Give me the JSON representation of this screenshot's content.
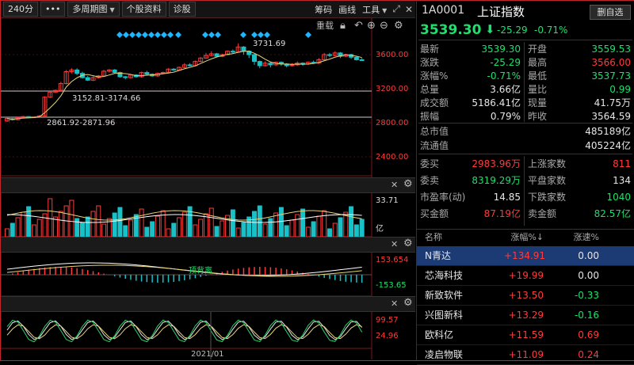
{
  "toolbar": {
    "period": "240分",
    "more": "•••",
    "multi_period": "多周期图",
    "stock_info": "个股资料",
    "diagnose": "诊股",
    "chips": "筹码",
    "draw": "画线",
    "tools": "工具"
  },
  "chart": {
    "overlay_label": "重载",
    "price_ticks": [
      "3600.00",
      "3200.00",
      "2800.00",
      "2400.00"
    ],
    "annot_high": "3731.69",
    "annot_range1": "3152.81-3174.66",
    "annot_range2": "2861.92-2871.96",
    "volume_top": "33.71",
    "volume_unit": "亿",
    "macd_top": "153.654",
    "macd_bottom": "-153.65",
    "macd_label": "顶背离",
    "kdj_top": "99.57",
    "kdj_bottom": "24.96",
    "date_label": "2021/01",
    "colors": {
      "up": "#ff3b3b",
      "down": "#18c0c8",
      "ma": "#e8d37a",
      "ma2": "#c0a060",
      "diamond": "#1fb6ff"
    },
    "candles": [
      [
        2820,
        2850,
        2810,
        2862
      ],
      [
        2845,
        2835,
        2825,
        2855
      ],
      [
        2835,
        2860,
        2830,
        2870
      ],
      [
        2860,
        2872,
        2850,
        2880
      ],
      [
        2872,
        2866,
        2858,
        2878
      ],
      [
        2866,
        2870,
        2860,
        2875
      ],
      [
        2870,
        2880,
        2865,
        2890
      ],
      [
        2880,
        3100,
        2875,
        3110
      ],
      [
        3100,
        3160,
        3090,
        3172
      ],
      [
        3160,
        3180,
        3150,
        3190
      ],
      [
        3180,
        3260,
        3170,
        3280
      ],
      [
        3260,
        3400,
        3250,
        3420
      ],
      [
        3400,
        3420,
        3380,
        3440
      ],
      [
        3420,
        3380,
        3360,
        3440
      ],
      [
        3380,
        3330,
        3320,
        3400
      ],
      [
        3330,
        3300,
        3290,
        3350
      ],
      [
        3300,
        3330,
        3290,
        3345
      ],
      [
        3330,
        3350,
        3320,
        3360
      ],
      [
        3350,
        3405,
        3340,
        3420
      ],
      [
        3405,
        3420,
        3390,
        3430
      ],
      [
        3420,
        3390,
        3380,
        3430
      ],
      [
        3390,
        3340,
        3330,
        3400
      ],
      [
        3340,
        3330,
        3310,
        3350
      ],
      [
        3330,
        3360,
        3320,
        3370
      ],
      [
        3360,
        3340,
        3330,
        3370
      ],
      [
        3340,
        3390,
        3330,
        3400
      ],
      [
        3390,
        3370,
        3360,
        3410
      ],
      [
        3370,
        3350,
        3340,
        3380
      ],
      [
        3350,
        3380,
        3340,
        3390
      ],
      [
        3380,
        3390,
        3370,
        3400
      ],
      [
        3390,
        3430,
        3380,
        3440
      ],
      [
        3430,
        3420,
        3410,
        3440
      ],
      [
        3420,
        3450,
        3410,
        3460
      ],
      [
        3450,
        3480,
        3440,
        3500
      ],
      [
        3480,
        3470,
        3460,
        3500
      ],
      [
        3470,
        3520,
        3460,
        3530
      ],
      [
        3520,
        3560,
        3510,
        3570
      ],
      [
        3560,
        3590,
        3550,
        3620
      ],
      [
        3590,
        3610,
        3580,
        3640
      ],
      [
        3610,
        3580,
        3570,
        3620
      ],
      [
        3580,
        3600,
        3570,
        3610
      ],
      [
        3600,
        3640,
        3590,
        3650
      ],
      [
        3640,
        3630,
        3610,
        3660
      ],
      [
        3630,
        3690,
        3620,
        3732
      ],
      [
        3690,
        3640,
        3600,
        3700
      ],
      [
        3640,
        3600,
        3560,
        3650
      ],
      [
        3600,
        3520,
        3480,
        3610
      ],
      [
        3520,
        3470,
        3440,
        3530
      ],
      [
        3470,
        3500,
        3460,
        3520
      ],
      [
        3500,
        3480,
        3450,
        3510
      ],
      [
        3480,
        3510,
        3470,
        3520
      ],
      [
        3510,
        3490,
        3470,
        3520
      ],
      [
        3490,
        3470,
        3450,
        3500
      ],
      [
        3470,
        3480,
        3460,
        3500
      ],
      [
        3480,
        3500,
        3470,
        3520
      ],
      [
        3500,
        3490,
        3470,
        3510
      ],
      [
        3490,
        3510,
        3480,
        3520
      ],
      [
        3510,
        3500,
        3490,
        3530
      ],
      [
        3500,
        3540,
        3490,
        3560
      ],
      [
        3540,
        3600,
        3530,
        3620
      ],
      [
        3600,
        3590,
        3570,
        3620
      ],
      [
        3590,
        3620,
        3580,
        3640
      ],
      [
        3620,
        3580,
        3560,
        3630
      ],
      [
        3580,
        3600,
        3570,
        3610
      ],
      [
        3600,
        3570,
        3550,
        3610
      ],
      [
        3570,
        3540,
        3530,
        3580
      ],
      [
        3540,
        3539,
        3530,
        3560
      ]
    ]
  },
  "quote": {
    "code": "1A0001",
    "name": "上证指数",
    "watch_btn": "删自选",
    "price": "3539.30",
    "change": "-25.29",
    "change_pct": "-0.71%",
    "rows": [
      {
        "l1": "最新",
        "v1": "3539.30",
        "c1": "green",
        "l2": "开盘",
        "v2": "3559.53",
        "c2": "green"
      },
      {
        "l1": "涨跌",
        "v1": "-25.29",
        "c1": "green",
        "l2": "最高",
        "v2": "3566.00",
        "c2": "red"
      },
      {
        "l1": "涨幅%",
        "v1": "-0.71%",
        "c1": "green",
        "l2": "最低",
        "v2": "3537.73",
        "c2": "green"
      },
      {
        "l1": "总量",
        "v1": "3.66亿",
        "c1": "white",
        "l2": "量比",
        "v2": "0.99",
        "c2": "green"
      },
      {
        "l1": "成交额",
        "v1": "5186.41亿",
        "c1": "white",
        "l2": "现量",
        "v2": "41.75万",
        "c2": "white"
      },
      {
        "l1": "振幅",
        "v1": "0.79%",
        "c1": "white",
        "l2": "昨收",
        "v2": "3564.59",
        "c2": "white"
      }
    ],
    "cap_rows": [
      {
        "l": "总市值",
        "v": "485189亿"
      },
      {
        "l": "流通值",
        "v": "405224亿"
      }
    ],
    "trade_rows": [
      {
        "l1": "委买",
        "v1": "2983.96万",
        "c1": "red",
        "l2": "上涨家数",
        "v2": "811",
        "c2": "red"
      },
      {
        "l1": "委卖",
        "v1": "8319.29万",
        "c1": "green",
        "l2": "平盘家数",
        "v2": "134",
        "c2": "white"
      },
      {
        "l1": "市盈率(动)",
        "v1": "14.85",
        "c1": "white",
        "l2": "下跌家数",
        "v2": "1040",
        "c2": "green"
      },
      {
        "l1": "买金额",
        "v1": "87.19亿",
        "c1": "red",
        "l2": "卖金额",
        "v2": "82.57亿",
        "c2": "green"
      }
    ]
  },
  "ranking": {
    "col_name": "名称",
    "col_pct": "涨幅%↓",
    "col_speed": "涨速%",
    "rows": [
      {
        "name": "N青达",
        "pct": "+134.91",
        "speed": "0.00",
        "speed_color": "white",
        "selected": true
      },
      {
        "name": "芯海科技",
        "pct": "+19.99",
        "speed": "0.00",
        "speed_color": "white",
        "selected": false
      },
      {
        "name": "新致软件",
        "pct": "+13.50",
        "speed": "-0.33",
        "speed_color": "green",
        "selected": false
      },
      {
        "name": "兴图新科",
        "pct": "+13.29",
        "speed": "-0.16",
        "speed_color": "green",
        "selected": false
      },
      {
        "name": "欧科亿",
        "pct": "+11.59",
        "speed": "0.69",
        "speed_color": "red",
        "selected": false
      },
      {
        "name": "凌启物联",
        "pct": "+11.09",
        "speed": "0.24",
        "speed_color": "red",
        "selected": false
      }
    ]
  }
}
